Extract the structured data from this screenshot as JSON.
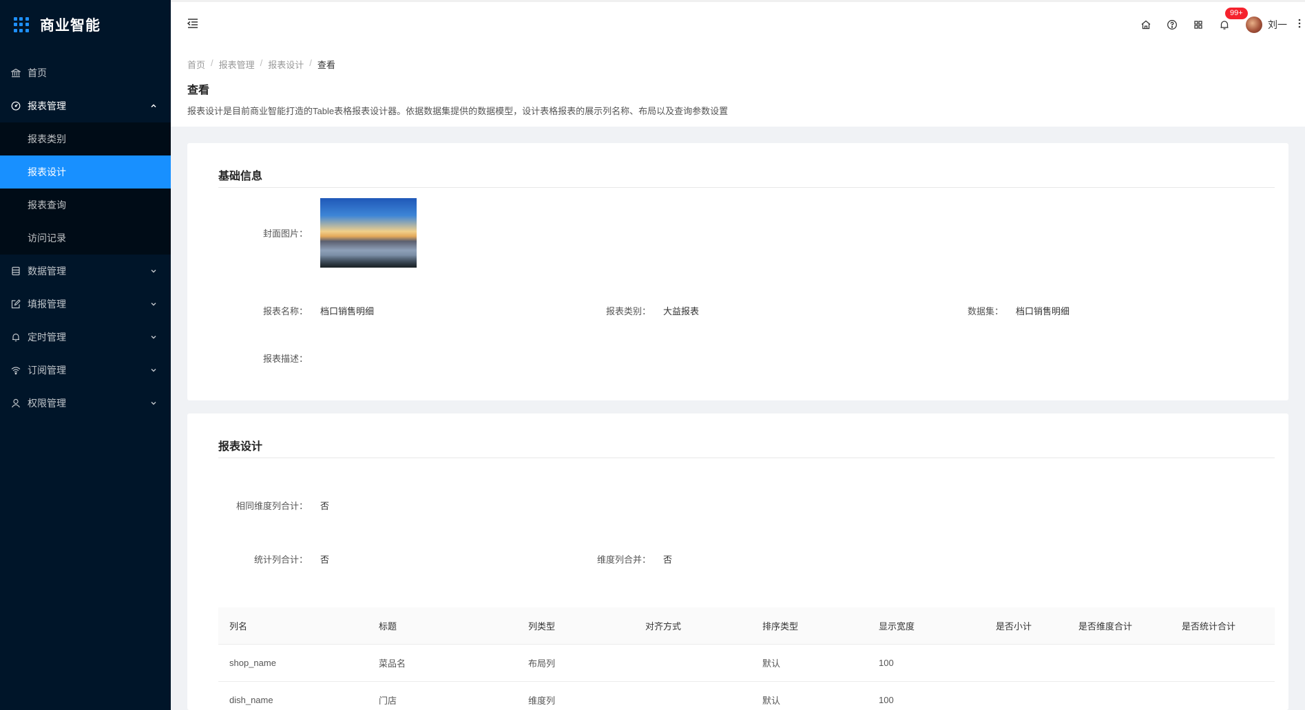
{
  "app": {
    "title": "商业智能"
  },
  "sidebar": {
    "items": [
      {
        "label": "首页",
        "icon": "bank-icon"
      },
      {
        "label": "报表管理",
        "icon": "dashboard-icon",
        "open": true,
        "children": [
          {
            "label": "报表类别"
          },
          {
            "label": "报表设计",
            "active": true
          },
          {
            "label": "报表查询"
          },
          {
            "label": "访问记录"
          }
        ]
      },
      {
        "label": "数据管理",
        "icon": "database-icon"
      },
      {
        "label": "填报管理",
        "icon": "edit-icon"
      },
      {
        "label": "定时管理",
        "icon": "bell-icon"
      },
      {
        "label": "订阅管理",
        "icon": "wifi-icon"
      },
      {
        "label": "权限管理",
        "icon": "user-icon"
      }
    ]
  },
  "header": {
    "notification_badge": "99+",
    "user_name": "刘一"
  },
  "breadcrumb": [
    "首页",
    "报表管理",
    "报表设计",
    "查看"
  ],
  "page": {
    "title": "查看",
    "description": "报表设计是目前商业智能打造的Table表格报表设计器。依据数据集提供的数据模型，设计表格报表的展示列名称、布局以及查询参数设置"
  },
  "basic_info": {
    "section_title": "基础信息",
    "cover_label": "封面图片：",
    "name_label": "报表名称：",
    "name_value": "档口销售明细",
    "category_label": "报表类别：",
    "category_value": "大益报表",
    "dataset_label": "数据集：",
    "dataset_value": "档口销售明细",
    "desc_label": "报表描述：",
    "desc_value": ""
  },
  "design": {
    "section_title": "报表设计",
    "same_dim_sum_label": "相同维度列合计：",
    "same_dim_sum_value": "否",
    "stat_sum_label": "统计列合计：",
    "stat_sum_value": "否",
    "dim_merge_label": "维度列合并：",
    "dim_merge_value": "否"
  },
  "table": {
    "headers": [
      "列名",
      "标题",
      "列类型",
      "对齐方式",
      "排序类型",
      "显示宽度",
      "是否小计",
      "是否维度合计",
      "是否统计合计"
    ],
    "rows": [
      [
        "shop_name",
        "菜品名",
        "布局列",
        "",
        "默认",
        "100",
        "",
        "",
        ""
      ],
      [
        "dish_name",
        "门店",
        "维度列",
        "",
        "默认",
        "100",
        "",
        "",
        ""
      ]
    ]
  },
  "colors": {
    "sidebar_bg": "#001529",
    "submenu_bg": "#000c17",
    "accent": "#1890ff",
    "badge": "#f5222d"
  }
}
